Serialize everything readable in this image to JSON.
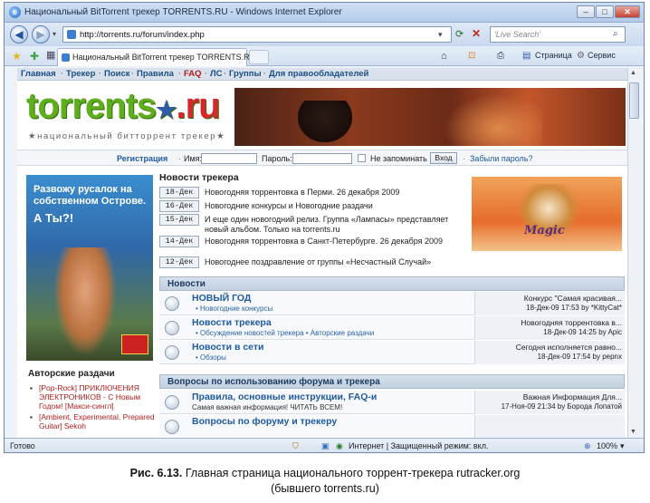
{
  "window": {
    "title": "Национальный BitTorrent трекер TORRENTS.RU - Windows Internet Explorer"
  },
  "nav": {
    "url": "http://torrents.ru/forum/index.php",
    "search_placeholder": "'Live Search'"
  },
  "tab": {
    "label": "Национальный BitTorrent трекер TORRENTS.RU"
  },
  "commandbar": {
    "page": "Страница",
    "tools": "Сервис"
  },
  "site": {
    "topnav": [
      "Главная",
      "Трекер",
      "Поиск",
      "Правила",
      "FAQ",
      "ЛС",
      "Группы",
      "Для правообладателей"
    ],
    "logo_main": "torrents",
    "logo_star": "★",
    "logo_ru": ".ru",
    "tagline": "★национальный битторрент трекер★",
    "login": {
      "register": "Регистрация",
      "name_label": "Имя:",
      "password_label": "Пароль:",
      "remember": "Не запоминать",
      "submit": "Вход",
      "forgot": "Забыли пароль?"
    },
    "left_ad": {
      "line1": "Развожу русалок на собственном Острове.",
      "line2": "А Ты?!"
    },
    "news_header": "Новости трекера",
    "news": [
      {
        "date": "18-Дек",
        "text": "Новогодняя торрентовка в Перми. 26 декабря 2009"
      },
      {
        "date": "16-Дек",
        "text": "Новогодние конкурсы и Новогодние раздачи"
      },
      {
        "date": "15-Дек",
        "text": "И еще один новогодний релиз. Группа «Лампасы» представляет новый альбом. Только на torrents.ru"
      },
      {
        "date": "14-Дек",
        "text": "Новогодняя торрентовка в Санкт-Петербурге. 26 декабря 2009"
      },
      {
        "date": "12-Дек",
        "text": "Новогоднее поздравление от группы «Несчастный Случай»"
      }
    ],
    "right_ad": {
      "label": "Magic"
    },
    "sections": [
      {
        "title": "Новости",
        "forums": [
          {
            "name": "НОВЫЙ ГОД",
            "sub": "• Новогодние конкурсы",
            "last_title": "Конкурс \"Самая красивая...",
            "last_meta": "18-Дек-09 17:53  by *KittyCat*"
          },
          {
            "name": "Новости трекера",
            "sub": "• Обсуждение новостей трекера • Авторские раздачи",
            "last_title": "Новогодняя торрентовка в...",
            "last_meta": "18-Дек-09 14:25  by Apic"
          },
          {
            "name": "Новости в сети",
            "sub": "• Обзоры",
            "last_title": "Сегодня исполняется равно...",
            "last_meta": "18-Дек-09 17:54  by pepnx"
          }
        ]
      },
      {
        "title": "Вопросы по использованию форума и трекера",
        "forums": [
          {
            "name": "Правила, основные инструкции, FAQ-и",
            "sub": "Самая важная информация! ЧИТАТЬ ВСЕМ!",
            "last_title": "Важная Информация Для...",
            "last_meta": "17-Ноя-09 21:34  by Борода Лопатой"
          },
          {
            "name": "Вопросы по форуму и трекеру",
            "sub": "",
            "last_title": "",
            "last_meta": ""
          }
        ]
      }
    ],
    "authors_header": "Авторские раздачи",
    "authors": [
      "[Pop-Rock] ПРИКЛЮЧЕНИЯ ЭЛЕКТРОНИКОВ - С Новым Годом! [Макси-сингл]",
      "[Ambient, Experimental, Prepared Guitar] Sekoh"
    ]
  },
  "status": {
    "left": "Готово",
    "zone": "Интернет | Защищенный режим: вкл.",
    "zoom": "100%"
  },
  "caption": {
    "label": "Рис. 6.13.",
    "text": "Главная страница национального торрент-трекера rutracker.org",
    "text2": "(бывшего torrents.ru)"
  }
}
